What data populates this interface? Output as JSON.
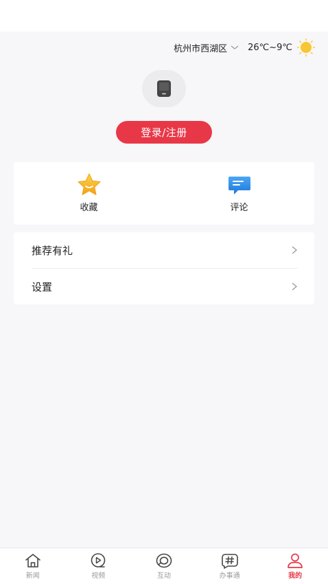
{
  "weather": {
    "location": "杭州市西湖区",
    "temperature": "26℃~9℃"
  },
  "profile": {
    "login_label": "登录/注册"
  },
  "quick_actions": [
    {
      "label": "收藏",
      "icon": "star-icon"
    },
    {
      "label": "评论",
      "icon": "comment-icon"
    }
  ],
  "menu": [
    {
      "label": "推荐有礼"
    },
    {
      "label": "设置"
    }
  ],
  "tabs": [
    {
      "label": "新闻",
      "icon": "home-icon"
    },
    {
      "label": "视频",
      "icon": "video-play-icon"
    },
    {
      "label": "互动",
      "icon": "interact-icon"
    },
    {
      "label": "办事通",
      "icon": "hashtag-icon"
    },
    {
      "label": "我的",
      "icon": "user-icon",
      "active": true
    }
  ],
  "colors": {
    "accent": "#e83848",
    "background": "#f7f6f8",
    "card": "#ffffff",
    "star": "#f5b21c",
    "comment": "#2f8ee8",
    "sun": "#f8c630"
  }
}
